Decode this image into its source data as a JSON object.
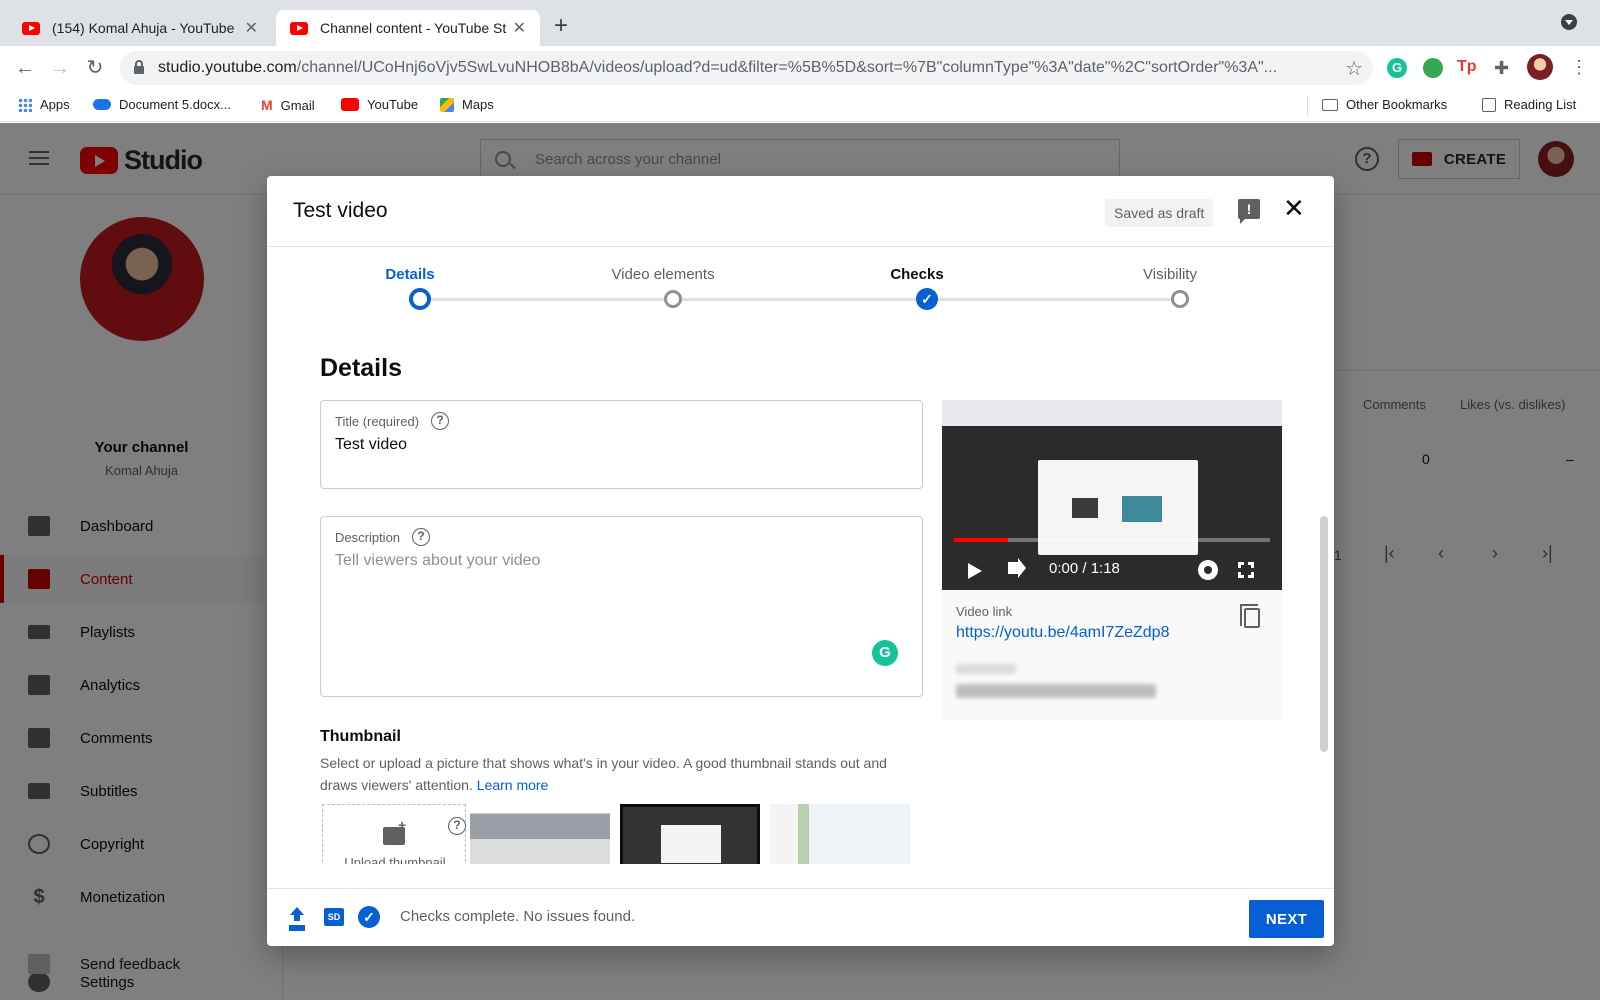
{
  "browser": {
    "tabs": [
      {
        "title": "(154) Komal Ahuja - YouTube"
      },
      {
        "title": "Channel content - YouTube Studio"
      }
    ],
    "url_host": "studio.youtube.com",
    "url_path": "/channel/UCoHnj6oVjv5SwLvuNHOB8bA/videos/upload?d=ud&filter=%5B%5D&sort=%7B\"columnType\"%3A\"date\"%2C\"sortOrder\"%3A\"...",
    "bookmarks": [
      "Apps",
      "Document 5.docx...",
      "Gmail",
      "YouTube",
      "Maps"
    ],
    "bookmarks_right": [
      "Other Bookmarks",
      "Reading List"
    ],
    "ext_grammarly_letter": "G",
    "ext_tp_label": "Tp"
  },
  "studio": {
    "logo_text": "Studio",
    "search_placeholder": "Search across your channel",
    "help_glyph": "?",
    "create_label": "CREATE",
    "channel_name": "Your channel",
    "channel_owner": "Komal Ahuja",
    "nav": [
      {
        "label": "Dashboard"
      },
      {
        "label": "Content"
      },
      {
        "label": "Playlists"
      },
      {
        "label": "Analytics"
      },
      {
        "label": "Comments"
      },
      {
        "label": "Subtitles"
      },
      {
        "label": "Copyright"
      },
      {
        "label": "Monetization"
      },
      {
        "label": "Settings"
      },
      {
        "label": "Send feedback"
      }
    ],
    "table_headers": [
      "Comments",
      "Likes (vs. dislikes)"
    ],
    "table_row_values": [
      "0",
      "–"
    ],
    "page_number": "1"
  },
  "dialog": {
    "title": "Test video",
    "saved_chip": "Saved as draft",
    "feedback_glyph": "!",
    "close_glyph": "✕",
    "steps": [
      {
        "label": "Details",
        "state": "current"
      },
      {
        "label": "Video elements",
        "state": "todo"
      },
      {
        "label": "Checks",
        "state": "done"
      },
      {
        "label": "Visibility",
        "state": "todo"
      }
    ],
    "check_glyph": "✓",
    "section_title": "Details",
    "title_field": {
      "label": "Title (required)",
      "value": "Test video"
    },
    "description_field": {
      "label": "Description",
      "placeholder": "Tell viewers about your video"
    },
    "help_glyph": "?",
    "thumbnail": {
      "title": "Thumbnail",
      "description": "Select or upload a picture that shows what's in your video. A good thumbnail stands out and draws viewers' attention.",
      "learn_more": "Learn more",
      "upload_label": "Upload thumbnail"
    },
    "video": {
      "time": "0:00 / 1:18",
      "progress": 0.17,
      "link_label": "Video link",
      "link": "https://youtu.be/4amI7ZeZdp8"
    },
    "footer": {
      "sd_badge": "SD",
      "status": "Checks complete. No issues found.",
      "next_label": "NEXT"
    }
  },
  "colors": {
    "accent_blue": "#065fd4",
    "yt_red": "#ff0000",
    "studio_active_red": "#cc0000"
  }
}
